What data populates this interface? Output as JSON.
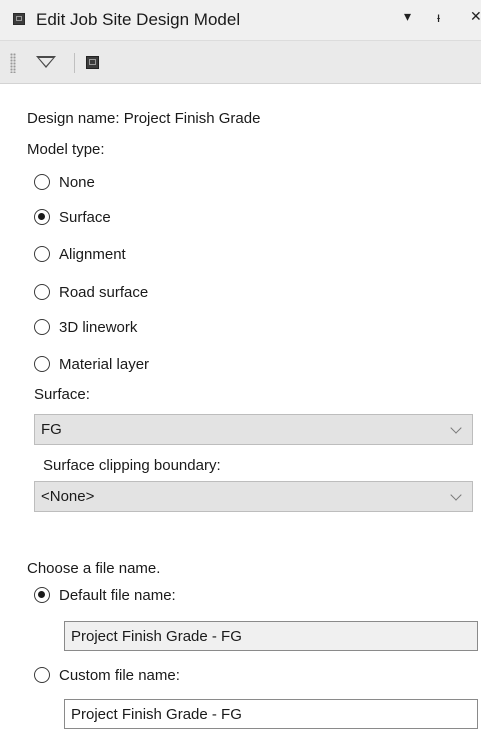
{
  "window": {
    "title": "Edit Job Site Design Model",
    "dropdown_glyph": "▾",
    "pin_glyph": "ᵼ",
    "close_glyph": "✕"
  },
  "form": {
    "design_name_label": "Design name: Project Finish Grade",
    "model_type_label": "Model type:",
    "model_types": [
      {
        "label": "None",
        "checked": false
      },
      {
        "label": "Surface",
        "checked": true
      },
      {
        "label": "Alignment",
        "checked": false
      },
      {
        "label": "Road surface",
        "checked": false
      },
      {
        "label": "3D linework",
        "checked": false
      },
      {
        "label": "Material layer",
        "checked": false
      }
    ],
    "surface_label": "Surface:",
    "surface_value": "FG",
    "clipping_label": "Surface clipping boundary:",
    "clipping_value": "<None>",
    "file_name_prompt": "Choose a file name.",
    "default_file_label": "Default file name:",
    "default_file_value": "Project Finish Grade - FG",
    "default_file_checked": true,
    "custom_file_label": "Custom file name:",
    "custom_file_value": "Project Finish Grade - FG",
    "custom_file_checked": false
  }
}
